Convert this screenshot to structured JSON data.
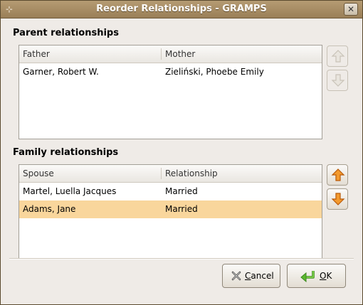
{
  "window": {
    "title": "Reorder Relationships - GRAMPS",
    "close_glyph": "✕",
    "menu_glyph": "⊹"
  },
  "parents": {
    "label": "Parent relationships",
    "columns": [
      "Father",
      "Mother"
    ],
    "rows": [
      {
        "father": "Garner, Robert W.",
        "mother": "Zieliński, Phoebe Emily",
        "selected": false
      }
    ],
    "up_enabled": false,
    "down_enabled": false
  },
  "families": {
    "label": "Family relationships",
    "columns": [
      "Spouse",
      "Relationship"
    ],
    "rows": [
      {
        "spouse": "Martel, Luella Jacques",
        "relationship": "Married",
        "selected": false
      },
      {
        "spouse": "Adams, Jane",
        "relationship": "Married",
        "selected": true
      }
    ],
    "up_enabled": true,
    "down_enabled": true
  },
  "buttons": {
    "cancel_label": "Cancel",
    "ok_label": "OK"
  },
  "colors": {
    "selection": "#f9d69c",
    "arrow_active": "#f0861c",
    "arrow_disabled": "#c9c3b8",
    "ok_icon": "#4fa82a",
    "titlebar": "#a88c63"
  }
}
